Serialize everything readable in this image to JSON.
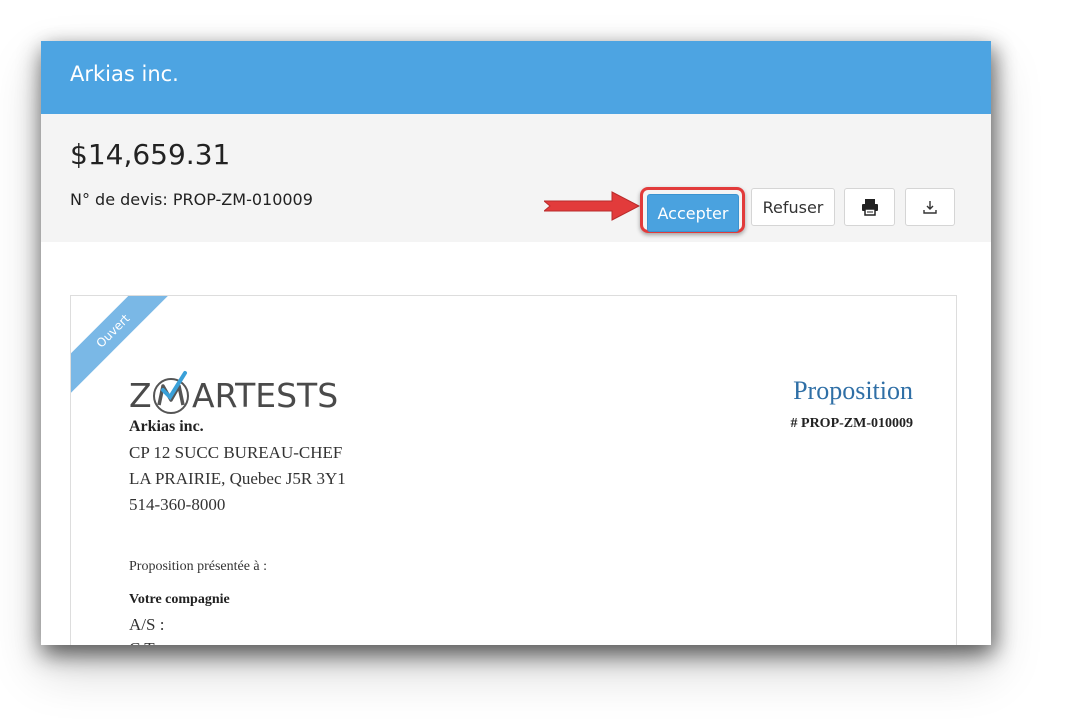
{
  "header": {
    "title": "Arkias inc.",
    "bg_color": "#4da4e2"
  },
  "summary": {
    "amount": "$14,659.31",
    "quote_label": "N° de devis: PROP-ZM-010009"
  },
  "actions": {
    "accept_label": "Accepter",
    "refuse_label": "Refuser",
    "print_icon": "print-icon",
    "download_icon": "download-icon",
    "accent_color": "#4aa2df",
    "highlight_color": "#e23b3b"
  },
  "document": {
    "status_ribbon": "Ouvert",
    "logo_text": {
      "first": "Z",
      "rest": "ARTESTS"
    },
    "company": {
      "name": "Arkias inc.",
      "address_line1": "CP 12 SUCC BUREAU-CHEF",
      "address_line2": "LA PRAIRIE, Quebec J5R 3Y1",
      "phone": "514-360-8000"
    },
    "proposal_title": "Proposition",
    "proposal_number": "# PROP-ZM-010009",
    "presented_to_label": "Proposition présentée à :",
    "client": {
      "name": "Votre compagnie",
      "attention": "A/S :",
      "cut_line": "C     T"
    }
  }
}
